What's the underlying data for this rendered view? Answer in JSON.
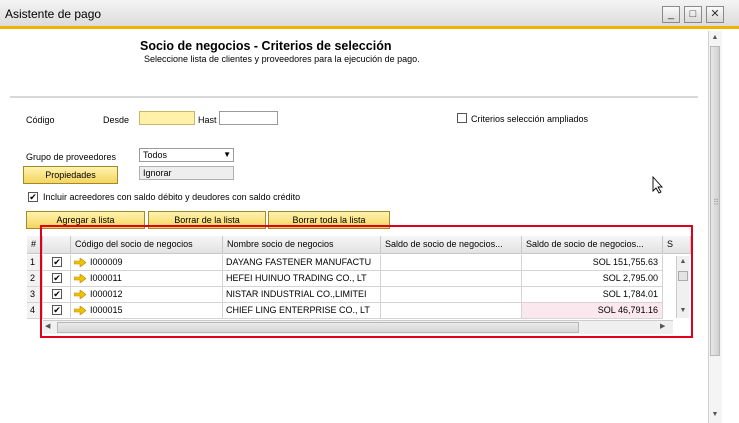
{
  "window": {
    "title": "Asistente de pago",
    "minimize": "_",
    "maximize": "□",
    "close": "✕"
  },
  "header": {
    "title": "Socio de negocios - Criterios de selección",
    "subtitle": "Seleccione lista de clientes y proveedores para la ejecución de pago."
  },
  "form": {
    "codigo_label": "Código",
    "desde_label": "Desde",
    "desde_value": "",
    "hasta_label": "Hast",
    "hasta_value": "",
    "criterios_label": "Criterios selección ampliados",
    "grupo_label": "Grupo de proveedores",
    "grupo_value": "Todos",
    "propiedades_label": "Propiedades",
    "ignorar_value": "Ignorar",
    "incluir_label": "Incluir acreedores con saldo débito y deudores con saldo crédito",
    "incluir_checked": true
  },
  "buttons": {
    "agregar": "Agregar a lista",
    "borrar": "Borrar de la lista",
    "borrar_toda": "Borrar toda la lista"
  },
  "grid": {
    "columns": [
      "#",
      "",
      "Código del socio de negocios",
      "Nombre socio de negocios",
      "Saldo de socio de negocios...",
      "Saldo de socio de negocios...",
      "S"
    ],
    "rows": [
      {
        "num": "1",
        "code": "I000009",
        "name": "DAYANG FASTENER MANUFACTU",
        "balance1": "",
        "balance2": "SOL 151,755.63"
      },
      {
        "num": "2",
        "code": "I000011",
        "name": "HEFEI HUINUO TRADING CO., LT",
        "balance1": "",
        "balance2": "SOL 2,795.00"
      },
      {
        "num": "3",
        "code": "I000012",
        "name": "NISTAR INDUSTRIAL CO.,LIMITEI",
        "balance1": "",
        "balance2": "SOL 1,784.01"
      },
      {
        "num": "4",
        "code": "I000015",
        "name": "CHIEF LING ENTERPRISE CO., LT",
        "balance1": "",
        "balance2": "SOL 46,791.16"
      }
    ]
  },
  "colors": {
    "accent": "#f0b400",
    "highlight": "#e0001a",
    "button": "#f5d560"
  }
}
